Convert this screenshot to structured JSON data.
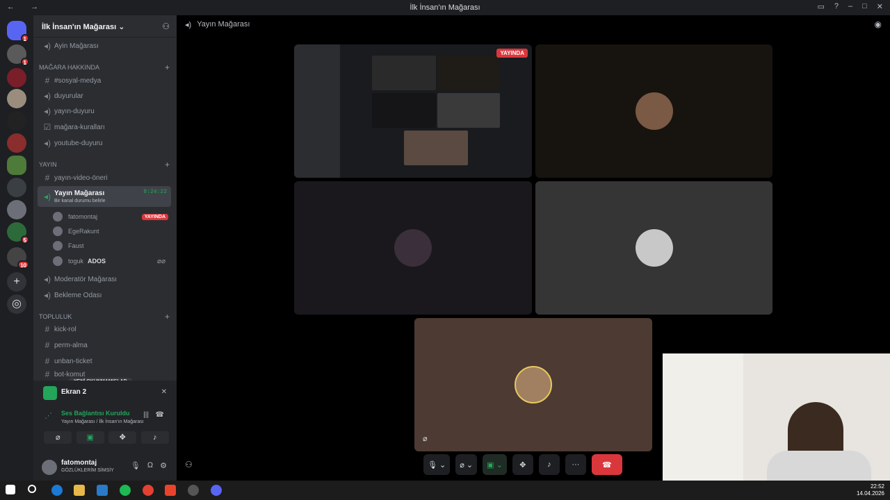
{
  "window": {
    "title": "İlk İnsan'ın Mağarası",
    "nav": "← →"
  },
  "guild": {
    "name": "İlk İnsan'ın Mağarası ⌄"
  },
  "server_badges": [
    "1",
    "1",
    "5",
    "10"
  ],
  "channels": {
    "top": "Ayin Mağarası",
    "cat1": "MAĞARA HAKKINDA",
    "cat1_items": [
      "#sosyal-medya",
      "duyurular",
      "yayın-duyuru",
      "mağara-kuralları",
      "youtube-duyuru"
    ],
    "cat2": "YAYIN",
    "cat2_items": [
      "yayın-video-öneri"
    ],
    "voice_active": "Yayın Mağarası",
    "voice_timer": "8:24:22",
    "voice_status": "Bir kanal durumu belirle",
    "members": [
      {
        "name": "fatomontaj",
        "badge": "YAYINDA"
      },
      {
        "name": "EgeRakunt"
      },
      {
        "name": "Faust"
      },
      {
        "name": "toguk",
        "extra": "ADOS"
      }
    ],
    "more_voice": [
      "Moderatör Mağarası",
      "Bekleme Odası"
    ],
    "cat3": "TOPLULUK",
    "cat3_items": [
      "kick-rol",
      "perm-alma",
      "unban-ticket",
      "bot-komut"
    ],
    "new_unread": "YENİ OKUNMAMIŞLAR"
  },
  "screenshare": {
    "label": "Ekran 2"
  },
  "voice_conn": {
    "status": "Ses Bağlantısı Kuruldu",
    "sub": "Yayın Mağarası / İlk İnsan'ın Mağarası"
  },
  "me": {
    "name": "fatomontaj",
    "status": "GÖZLÜKLERİM SİMSİY"
  },
  "stage": {
    "title": "Yayın Mağarası",
    "live_badge": "YAYINDA"
  },
  "clock": {
    "time": "22:52",
    "date": "14.04.2026"
  },
  "colors": {
    "bg": "#000000",
    "sidebar": "#2b2d31",
    "accent_red": "#da373c",
    "accent_green": "#23a55a"
  },
  "icons": [
    "discord-icon",
    "speaker-icon",
    "hash-icon",
    "mic-icon",
    "headphone-icon",
    "gear-icon",
    "end-call-icon",
    "screen-share-icon"
  ]
}
